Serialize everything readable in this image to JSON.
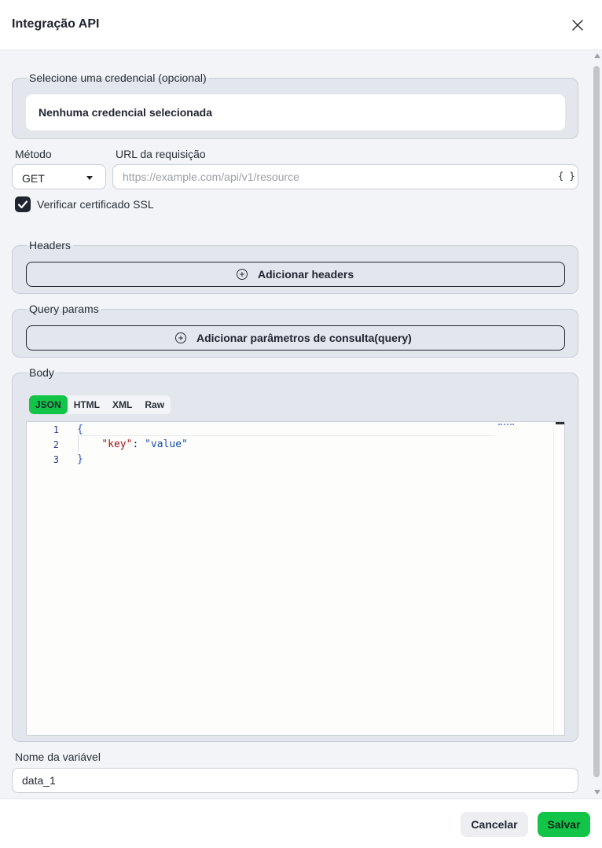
{
  "header": {
    "title": "Integração API"
  },
  "credential": {
    "legend": "Selecione uma credencial (opcional)",
    "value": "Nenhuma credencial selecionada"
  },
  "request": {
    "method_label": "Método",
    "method_value": "GET",
    "url_label": "URL da requisição",
    "url_placeholder": "https://example.com/api/v1/resource",
    "variable_icon": "{ }",
    "ssl_label": "Verificar certificado SSL",
    "ssl_checked": true
  },
  "headers": {
    "legend": "Headers",
    "add_label": "Adicionar headers"
  },
  "query": {
    "legend": "Query params",
    "add_label": "Adicionar parâmetros de consulta(query)"
  },
  "body": {
    "legend": "Body",
    "tabs": [
      "JSON",
      "HTML",
      "XML",
      "Raw"
    ],
    "active_tab": "JSON",
    "line_numbers": [
      "1",
      "2",
      "3"
    ],
    "code": {
      "open_brace": "{",
      "key": "\"key\"",
      "separator": ": ",
      "value": "\"value\"",
      "close_brace": "}"
    }
  },
  "variable": {
    "label": "Nome da variável",
    "value": "data_1"
  },
  "footer": {
    "cancel_label": "Cancelar",
    "save_label": "Salvar"
  },
  "colors": {
    "accent": "#12c548",
    "panel": "#e3e6ec",
    "background": "#f2f4f7",
    "text": "#1f2430"
  },
  "icons": {
    "close": "close-icon",
    "dropdown": "chevron-down-icon",
    "check": "check-icon",
    "add": "plus-circle-icon"
  }
}
